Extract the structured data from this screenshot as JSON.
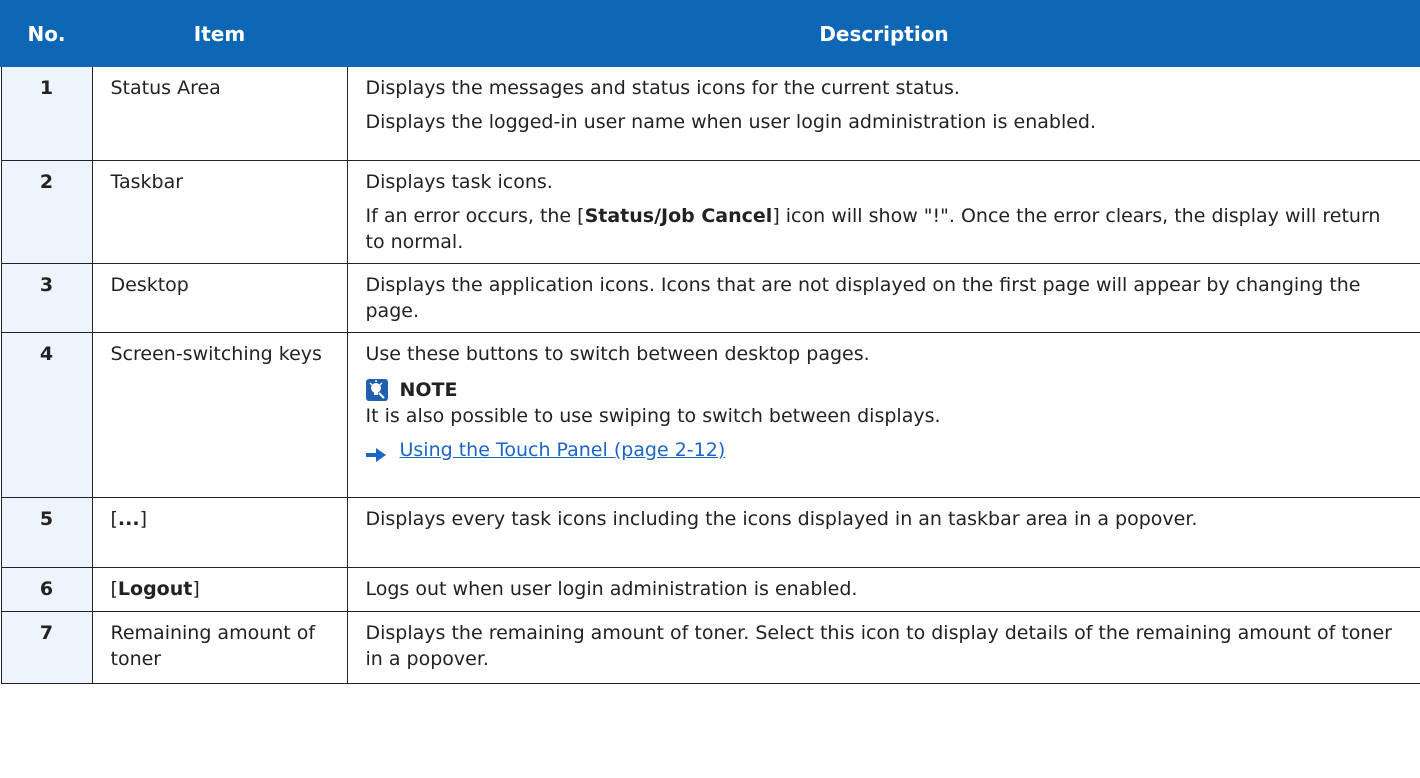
{
  "headers": {
    "no": "No.",
    "item": "Item",
    "description": "Description"
  },
  "rows": [
    {
      "no": "1",
      "item": "Status Area",
      "desc": [
        "Displays the messages and status icons for the current status.",
        "Displays the logged-in user name when user login administration is enabled."
      ]
    },
    {
      "no": "2",
      "item": "Taskbar",
      "desc_first": "Displays task icons.",
      "desc_prefix": "If an error occurs, the [",
      "desc_bold": "Status/Job Cancel",
      "desc_suffix": "] icon will show \"!\". Once the error clears, the display will return to normal."
    },
    {
      "no": "3",
      "item": "Desktop",
      "desc": [
        "Displays the application icons. Icons that are not displayed on the first page will appear by changing the page."
      ]
    },
    {
      "no": "4",
      "item": "Screen-switching keys",
      "desc_first": "Use these buttons to switch between desktop pages.",
      "note_label": "NOTE",
      "note_text": "It is also possible to use swiping to switch between displays.",
      "link_text": "Using the Touch Panel (page 2-12)"
    },
    {
      "no": "5",
      "item_prefix": "[",
      "item_bold": "...",
      "item_suffix": "]",
      "desc": [
        "Displays every task icons including the icons displayed in an taskbar area in a popover."
      ]
    },
    {
      "no": "6",
      "item_prefix": "[",
      "item_bold": "Logout",
      "item_suffix": "]",
      "desc": [
        "Logs out when user login administration is enabled."
      ]
    },
    {
      "no": "7",
      "item": "Remaining amount of toner",
      "desc": [
        "Displays the remaining amount of toner. Select this icon to display details of the remaining amount of toner in a popover."
      ]
    }
  ]
}
